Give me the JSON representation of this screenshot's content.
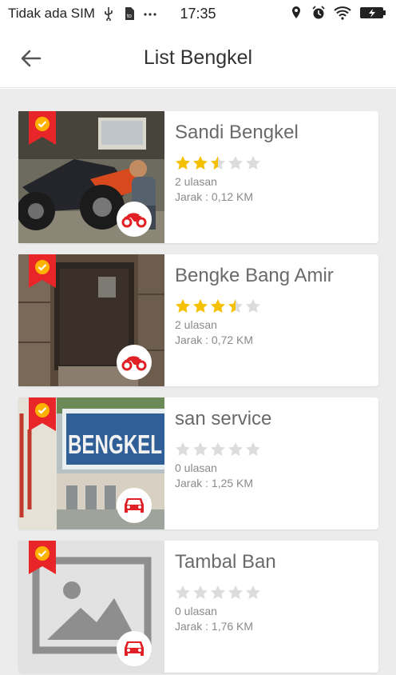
{
  "status_bar": {
    "carrier": "Tidak ada SIM",
    "time": "17:35",
    "icons": [
      "usb-icon",
      "sim-card-icon",
      "more-dots-icon",
      "location-pin-icon",
      "alarm-icon",
      "wifi-icon",
      "battery-charging-icon"
    ]
  },
  "app_bar": {
    "title": "List Bengkel",
    "back_icon": "arrow-left-icon"
  },
  "colors": {
    "star_filled": "#f5c000",
    "star_empty": "#dcdcdc",
    "ribbon": "#e8262a",
    "ribbon_check": "#ffb300",
    "vehicle_icon": "#e02024",
    "list_background": "#ececec"
  },
  "workshops": [
    {
      "name": "Sandi Bengkel",
      "rating": 2.5,
      "reviews": "2 ulasan",
      "distance": "Jarak : 0,12 KM",
      "vehicle_type": "motorcycle-icon",
      "photo": "mechanic-repairing-scooter"
    },
    {
      "name": "Bengke Bang Amir",
      "rating": 3.5,
      "reviews": "2 ulasan",
      "distance": "Jarak : 0,72 KM",
      "vehicle_type": "motorcycle-icon",
      "photo": "wooden-garage-door"
    },
    {
      "name": "san service",
      "rating": 0,
      "reviews": "0 ulasan",
      "distance": "Jarak : 1,25 KM",
      "vehicle_type": "car-icon",
      "photo": "bengkel-signboard",
      "photo_text": "BENGKEL"
    },
    {
      "name": "Tambal Ban",
      "rating": 0,
      "reviews": "0 ulasan",
      "distance": "Jarak : 1,76 KM",
      "vehicle_type": "car-icon",
      "photo": "image-placeholder"
    }
  ]
}
